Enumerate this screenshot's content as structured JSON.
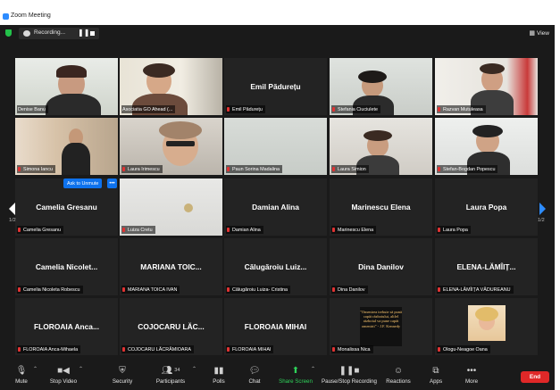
{
  "window": {
    "title": "Zoom Meeting"
  },
  "topbar": {
    "recording_label": "Recording...",
    "view_label": "View"
  },
  "participants": [
    {
      "name": "Denise Banu",
      "big": "",
      "active": true
    },
    {
      "name": "Asociatia GO Ahead (...",
      "big": ""
    },
    {
      "name": "Emil Pădurețu",
      "big": "Emil Pădurețu"
    },
    {
      "name": "Stefania Ciuciulete",
      "big": ""
    },
    {
      "name": "Razvan Mutuleasa",
      "big": ""
    },
    {
      "name": "Simona Iancu",
      "big": ""
    },
    {
      "name": "Laura Irimescu",
      "big": ""
    },
    {
      "name": "Paun Sorina Madalina",
      "big": ""
    },
    {
      "name": "Laura Simion",
      "big": ""
    },
    {
      "name": "Stefan-Bogdan Popescu",
      "big": ""
    },
    {
      "name": "Camelia Gresanu",
      "big": "Camelia Gresanu"
    },
    {
      "name": "Luiza Cretu",
      "big": ""
    },
    {
      "name": "Damian Alina",
      "big": "Damian Alina"
    },
    {
      "name": "Marinescu Elena",
      "big": "Marinescu Elena"
    },
    {
      "name": "Laura Popa",
      "big": "Laura Popa"
    },
    {
      "name": "Camelia Nicoleta Robescu",
      "big": "Camelia Nicolet..."
    },
    {
      "name": "MARIANA TOICA IVAN",
      "big": "MARIANA TOIC..."
    },
    {
      "name": "Călugăroiu Luiza- Cristina",
      "big": "Călugăroiu Luiz..."
    },
    {
      "name": "Dina Danilov",
      "big": "Dina Danilov"
    },
    {
      "name": "ELENA-LĂMÎIȚA VĂDUREANU",
      "big": "ELENA-LĂMÎIȚ..."
    },
    {
      "name": "FLOROAIA Anca-Mihaela",
      "big": "FLOROAIA Anca..."
    },
    {
      "name": "COJOCARU LĂCRĂMIOARA",
      "big": "COJOCARU LĂC..."
    },
    {
      "name": "FLOROAIA MIHAI",
      "big": "FLOROAIA MIHAI"
    },
    {
      "name": "Monalissa Nica",
      "big": ""
    },
    {
      "name": "Ologu-Neagoe Oana",
      "big": ""
    }
  ],
  "overlay": {
    "ask_to_unmute": "Ask to Unmute",
    "more": "•••"
  },
  "quote_text": "\"Omenirea trebuie să pună capăt războiului, altfel războiul va pune capăt omenirii\" - J.F. Kennedy",
  "pagination": {
    "left": "1/2",
    "right": "1/2"
  },
  "toolbar": {
    "mute": "Mute",
    "stop_video": "Stop Video",
    "security": "Security",
    "participants": "Participants",
    "participants_count": "34",
    "polls": "Polls",
    "chat": "Chat",
    "share_screen": "Share Screen",
    "record": "Pause/Stop Recording",
    "reactions": "Reactions",
    "apps": "Apps",
    "more": "More",
    "end": "End"
  },
  "colors": {
    "accent": "#2d8cff",
    "active_speaker": "#c6d93b",
    "share_green": "#2fd35a",
    "end_red": "#e02828"
  }
}
